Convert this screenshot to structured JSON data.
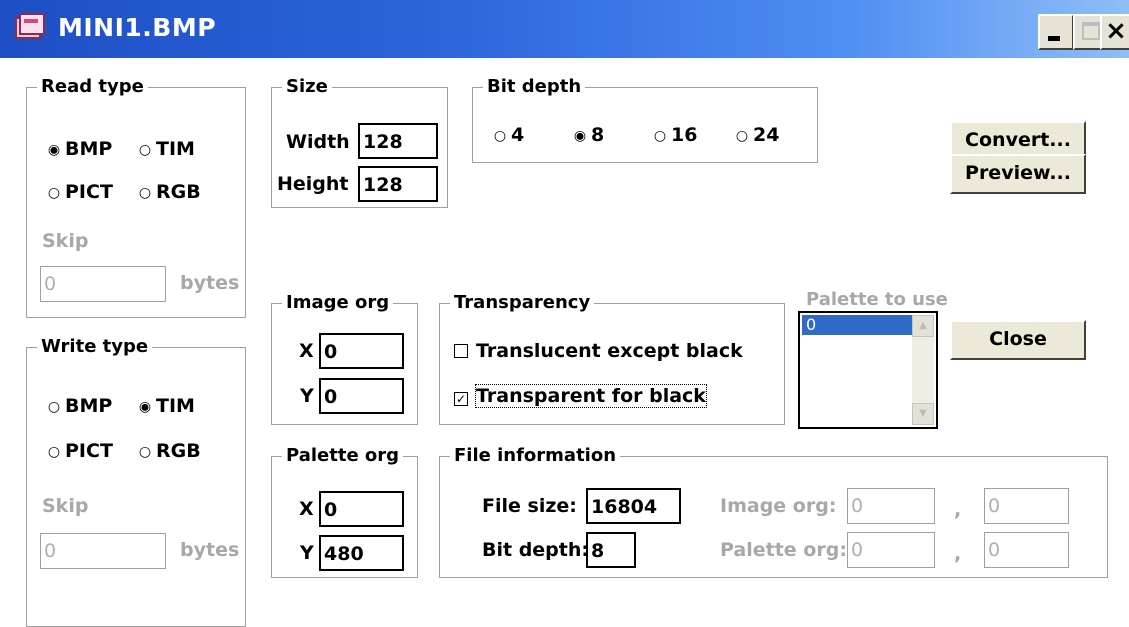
{
  "window": {
    "title": "MINI1.BMP",
    "minimize_glyph": "_",
    "close_glyph": "×"
  },
  "read_type": {
    "legend": "Read type",
    "options": [
      {
        "label": "BMP",
        "selected": true,
        "enabled": true
      },
      {
        "label": "TIM",
        "selected": false,
        "enabled": false
      },
      {
        "label": "PICT",
        "selected": false,
        "enabled": false
      },
      {
        "label": "RGB",
        "selected": false,
        "enabled": true
      }
    ],
    "skip_label": "Skip",
    "skip_value": "0",
    "bytes_label": "bytes"
  },
  "size": {
    "legend": "Size",
    "width_label": "Width",
    "width_value": "128",
    "height_label": "Height",
    "height_value": "128"
  },
  "bit_depth": {
    "legend": "Bit depth",
    "options": [
      {
        "label": "4",
        "selected": false
      },
      {
        "label": "8",
        "selected": true
      },
      {
        "label": "16",
        "selected": false
      },
      {
        "label": "24",
        "selected": false
      }
    ]
  },
  "buttons": {
    "convert": "Convert...",
    "preview": "Preview...",
    "close": "Close"
  },
  "write_type": {
    "legend": "Write type",
    "options": [
      {
        "label": "BMP",
        "selected": false
      },
      {
        "label": "TIM",
        "selected": true
      },
      {
        "label": "PICT",
        "selected": false
      },
      {
        "label": "RGB",
        "selected": false
      }
    ],
    "skip_label": "Skip",
    "skip_value": "0",
    "bytes_label": "bytes"
  },
  "image_org": {
    "legend": "Image org",
    "x_label": "X",
    "x_value": "0",
    "y_label": "Y",
    "y_value": "0"
  },
  "transparency": {
    "legend": "Transparency",
    "translucent_label": "Translucent except black",
    "translucent_checked": false,
    "transparent_label": "Transparent for black",
    "transparent_checked": true,
    "check_glyph": "✓"
  },
  "palette_to_use": {
    "label": "Palette to use",
    "items": [
      "0"
    ],
    "selected_index": 0
  },
  "palette_org": {
    "legend": "Palette org",
    "x_label": "X",
    "x_value": "0",
    "y_label": "Y",
    "y_value": "480"
  },
  "file_information": {
    "legend": "File information",
    "file_size_label": "File size:",
    "file_size_value": "16804",
    "bit_depth_label": "Bit depth:",
    "bit_depth_value": "8",
    "image_org_label": "Image org:",
    "image_org_x": "0",
    "image_org_y": "0",
    "palette_org_label": "Palette org:",
    "palette_org_x": "0",
    "palette_org_y": "0",
    "separator": ","
  },
  "colors": {
    "titlebar_start": "#1e4fc4",
    "titlebar_end": "#8fbef7",
    "selection": "#3169c6",
    "disabled_text": "#a8a8a8",
    "button_face": "#ece9d8"
  },
  "glyphs": {
    "radio_on": "◉",
    "radio_off": "○"
  }
}
